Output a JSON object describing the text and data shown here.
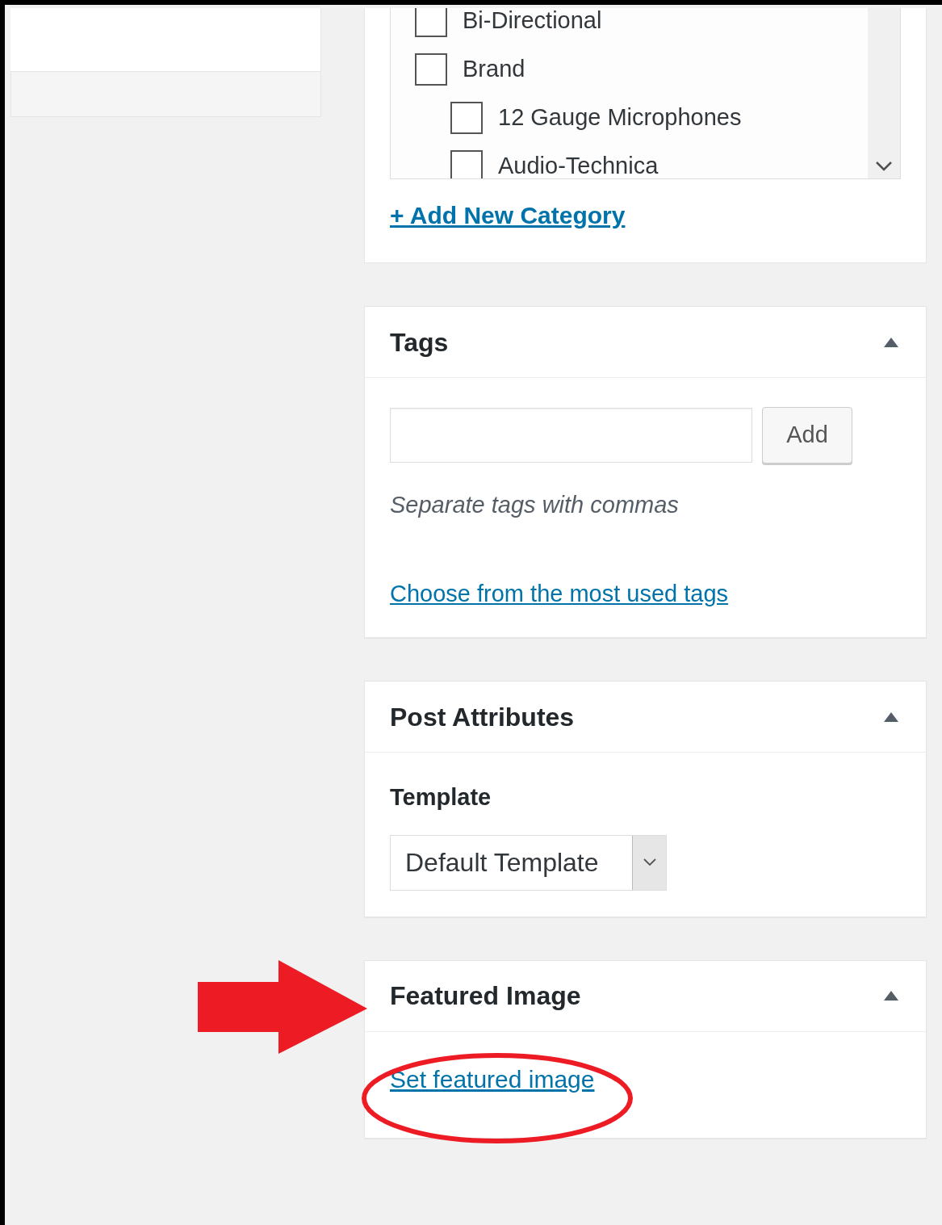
{
  "categories": {
    "items": [
      {
        "label": "Bi-Directional",
        "checked": false
      },
      {
        "label": "Brand",
        "checked": false,
        "children": [
          {
            "label": "12 Gauge Microphones",
            "checked": false
          },
          {
            "label": "Audio-Technica",
            "checked": false
          }
        ]
      }
    ],
    "add_link": "+ Add New Category"
  },
  "tags": {
    "title": "Tags",
    "expanded": true,
    "add_button": "Add",
    "hint": "Separate tags with commas",
    "link": "Choose from the most used tags"
  },
  "post_attributes": {
    "title": "Post Attributes",
    "expanded": true,
    "template_label": "Template",
    "template_value": "Default Template"
  },
  "featured_image": {
    "title": "Featured Image",
    "expanded": true,
    "link": "Set featured image"
  }
}
